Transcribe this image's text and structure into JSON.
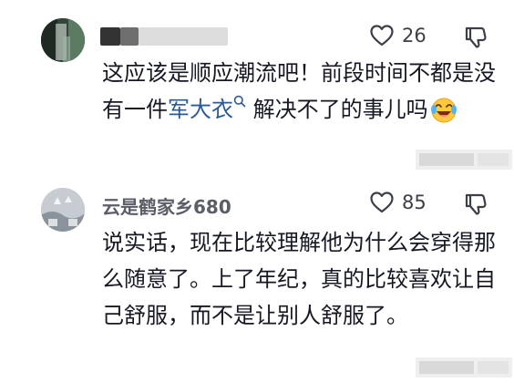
{
  "comments": [
    {
      "username": "",
      "likes": "26",
      "text_before": "这应该是顺应潮流吧！前段时间不都是没有一件",
      "keyword": "军大衣",
      "text_after": "解决不了的事儿吗"
    },
    {
      "username": "云是鹤家乡680",
      "likes": "85",
      "text": "说实话，现在比较理解他为什么会穿得那么随意了。上了年纪，真的比较喜欢让自己舒服，而不是让别人舒服了。"
    }
  ],
  "icons": {
    "like": "heart-outline-icon",
    "dislike": "thumb-down-outline-icon",
    "search": "search-mini-icon",
    "emoji": "laughing-crying-emoji"
  },
  "colors": {
    "keyword": "#2b5a94",
    "text": "#161823",
    "secondary": "#6b6e76"
  }
}
